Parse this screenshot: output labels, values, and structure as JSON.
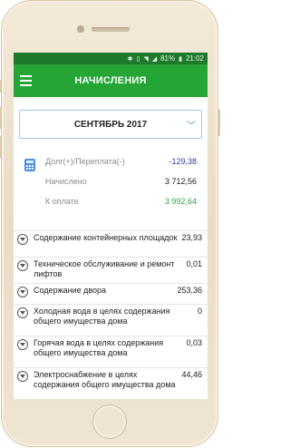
{
  "status": {
    "battery": "81%",
    "time": "21:02"
  },
  "header": {
    "title": "НАЧИСЛЕНИЯ"
  },
  "period": {
    "selected": "СЕНТЯБРЬ 2017"
  },
  "summary": {
    "debt_label": "Долг(+)/Переплата(-)",
    "debt_value": "-129,38",
    "accrued_label": "Начислено",
    "accrued_value": "3 712,56",
    "topay_label": "К оплате",
    "topay_value": "3 992,64"
  },
  "items": [
    {
      "name": "Содержание контейнерных площадок",
      "value": "23,93"
    },
    {
      "name": "Техническое обслуживание и ремонт лифтов",
      "value": "0,01"
    },
    {
      "name": "Содержание двора",
      "value": "253,36"
    },
    {
      "name": "Холодная вода в целях содержания общего имущества дома",
      "value": "0"
    },
    {
      "name": "Горячая вода в целях содержания общего имущества дома",
      "value": "0,03"
    },
    {
      "name": "Электроснабжение в целях содержания общего имущества дома",
      "value": "44,46"
    }
  ],
  "colors": {
    "appbar": "#25a536",
    "statusbar": "#1d7a2b",
    "negative": "#2a3aa8",
    "pay": "#2fa84a"
  }
}
